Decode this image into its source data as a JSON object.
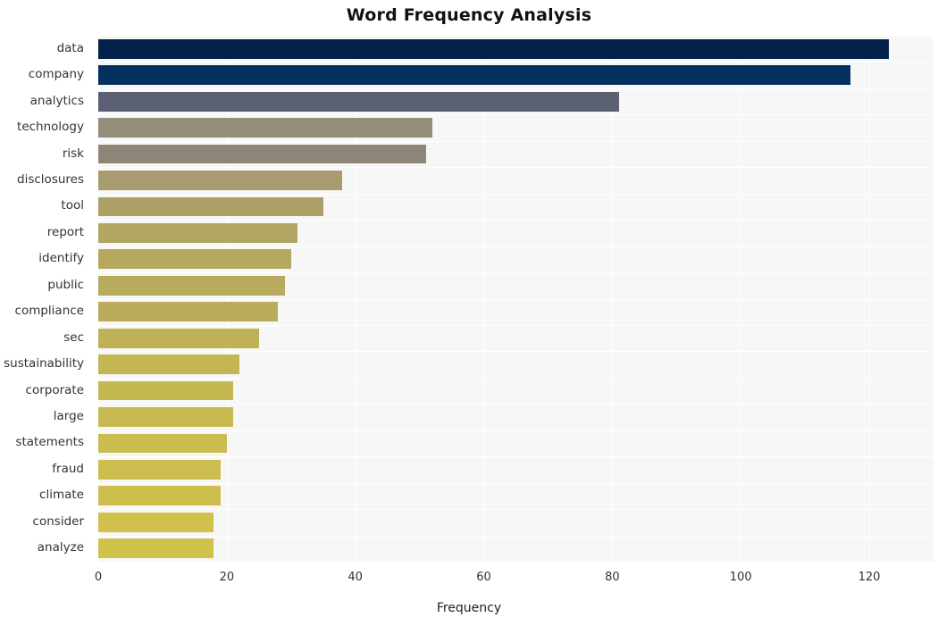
{
  "chart_data": {
    "type": "bar",
    "orientation": "horizontal",
    "title": "Word Frequency Analysis",
    "xlabel": "Frequency",
    "ylabel": "",
    "xlim": [
      0,
      130
    ],
    "grid": true,
    "legend": null,
    "xticks": [
      0,
      20,
      40,
      60,
      80,
      100,
      120
    ],
    "categories": [
      "data",
      "company",
      "analytics",
      "technology",
      "risk",
      "disclosures",
      "tool",
      "report",
      "identify",
      "public",
      "compliance",
      "sec",
      "sustainability",
      "corporate",
      "large",
      "statements",
      "fraud",
      "climate",
      "consider",
      "analyze"
    ],
    "values": [
      123,
      117,
      81,
      52,
      51,
      38,
      35,
      31,
      30,
      29,
      28,
      25,
      22,
      21,
      21,
      20,
      19,
      19,
      18,
      18
    ],
    "bar_colors": [
      "#03234b",
      "#03305e",
      "#5b6072",
      "#948d7a",
      "#8e8777",
      "#a89c6e",
      "#ada067",
      "#b2a663",
      "#b5a860",
      "#b8ab5e",
      "#baac5c",
      "#bfb157",
      "#c4b653",
      "#c6b851",
      "#c8ba50",
      "#cabc4f",
      "#ccbe4e",
      "#cdbf4d",
      "#cfc14c",
      "#d0c24b"
    ],
    "plot_background": "#f7f7f7",
    "grid_color": "#ffffff",
    "title_color": "#111111",
    "tick_color": "#333333"
  }
}
